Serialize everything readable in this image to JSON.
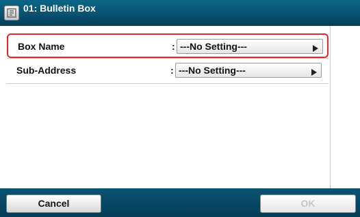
{
  "header": {
    "title": "01: Bulletin Box",
    "icon": "bulletin-box-icon"
  },
  "settings": {
    "rows": [
      {
        "label": "Box Name",
        "separator": ":",
        "value": "---No Setting---",
        "selected": true
      },
      {
        "label": "Sub-Address",
        "separator": ":",
        "value": "---No Setting---",
        "selected": false
      }
    ]
  },
  "footer": {
    "cancel_label": "Cancel",
    "ok_label": "OK"
  },
  "colors": {
    "header_bg": "#0a5676",
    "selection_border": "#e2262c",
    "footer_bg": "#063c55"
  }
}
